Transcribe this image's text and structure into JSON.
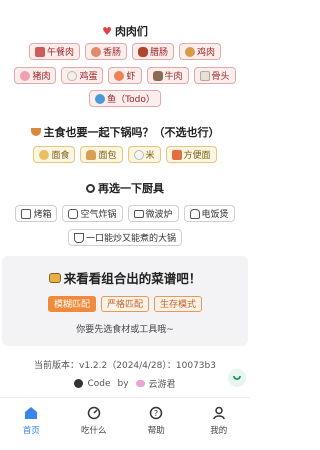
{
  "meat": {
    "title": "肉肉们",
    "rows": [
      [
        {
          "label": "午餐肉",
          "icon": "luncheon-meat-icon"
        },
        {
          "label": "香肠",
          "icon": "sausage-icon"
        },
        {
          "label": "腊肠",
          "icon": "cured-sausage-icon"
        },
        {
          "label": "鸡肉",
          "icon": "chicken-icon"
        }
      ],
      [
        {
          "label": "猪肉",
          "icon": "pig-icon"
        },
        {
          "label": "鸡蛋",
          "icon": "egg-icon"
        },
        {
          "label": "虾",
          "icon": "shrimp-icon"
        },
        {
          "label": "牛肉",
          "icon": "cow-icon"
        },
        {
          "label": "骨头",
          "icon": "bone-icon"
        }
      ],
      [
        {
          "label": "鱼（Todo）",
          "icon": "fish-icon"
        }
      ]
    ]
  },
  "staple": {
    "title": "主食也要一起下锅吗？（不选也行）",
    "items": [
      {
        "label": "面食",
        "icon": "noodles-icon"
      },
      {
        "label": "面包",
        "icon": "bread-icon"
      },
      {
        "label": "米",
        "icon": "rice-icon"
      },
      {
        "label": "方便面",
        "icon": "instant-noodles-icon"
      }
    ]
  },
  "tools": {
    "title": "再选一下厨具",
    "items": [
      {
        "label": "烤箱",
        "icon": "oven-icon"
      },
      {
        "label": "空气炸锅",
        "icon": "air-fryer-icon"
      },
      {
        "label": "微波炉",
        "icon": "microwave-icon"
      },
      {
        "label": "电饭煲",
        "icon": "rice-cooker-icon"
      }
    ],
    "wide": {
      "label": "一口能炒又能煮的大锅",
      "icon": "pot-icon"
    }
  },
  "combo": {
    "title": "来看看组合出的菜谱吧！",
    "modes": [
      "模糊匹配",
      "严格匹配",
      "生存模式"
    ],
    "active_mode": "模糊匹配",
    "hint": "你要先选食材或工具哦~"
  },
  "footer": {
    "version": "当前版本：v1.2.2（2024/4/28）：10073b3",
    "code_by_prefix": "Code",
    "code_by_word": "by",
    "author": "云游君"
  },
  "tabs": [
    {
      "label": "首页",
      "icon": "home-icon",
      "active": true
    },
    {
      "label": "吃什么",
      "icon": "gauge-icon",
      "active": false
    },
    {
      "label": "帮助",
      "icon": "help-icon",
      "active": false
    },
    {
      "label": "我的",
      "icon": "user-icon",
      "active": false
    }
  ],
  "colors": {
    "accent": "#3a86e8",
    "meat_bg": "#fdeeee",
    "staple_bg": "#fdf6e2",
    "mode_active": "#ef8a3a"
  }
}
